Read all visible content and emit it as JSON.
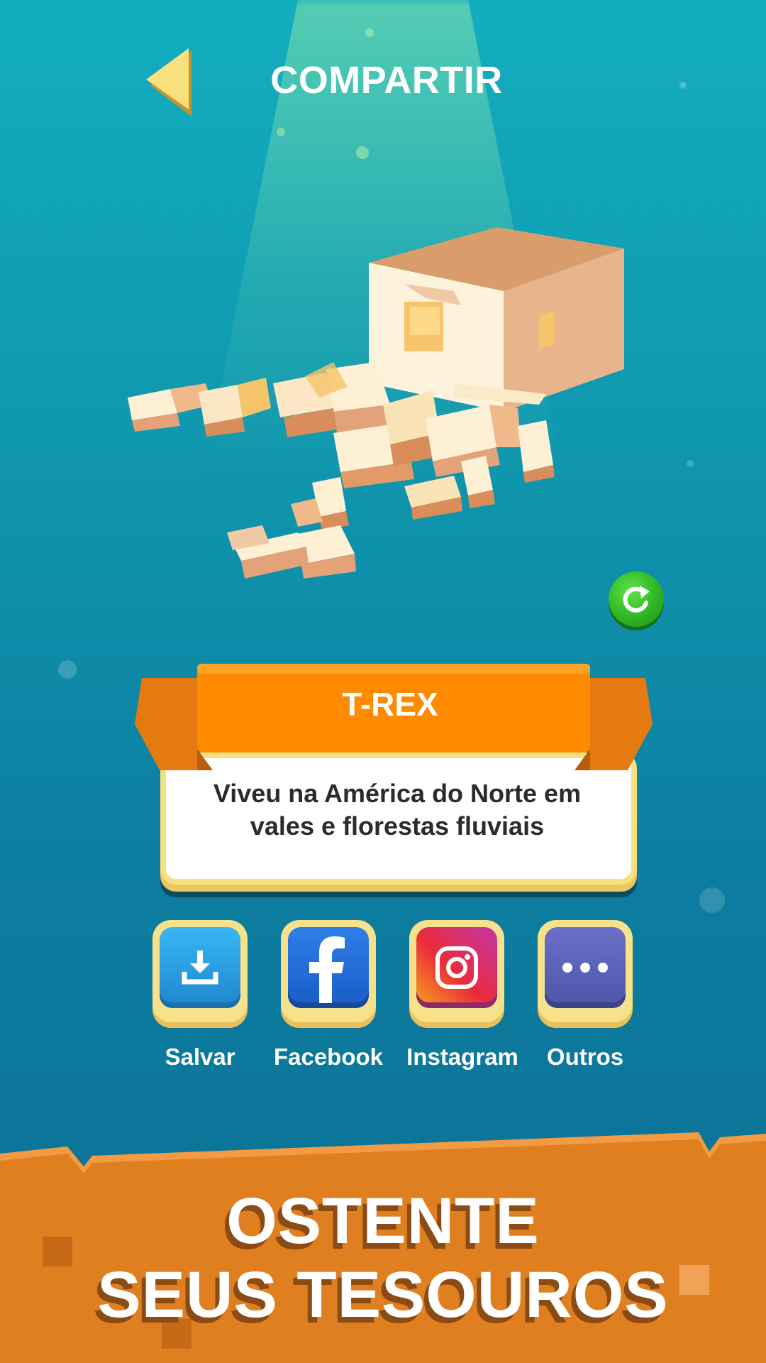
{
  "header": {
    "title": "COMPARTIR"
  },
  "creature": {
    "name": "T-REX",
    "description_line1": "Viveu na América do Norte em",
    "description_line2": "vales e florestas fluviais"
  },
  "share": {
    "buttons": [
      {
        "label": "Salvar",
        "icon": "download-icon"
      },
      {
        "label": "Facebook",
        "icon": "facebook-icon"
      },
      {
        "label": "Instagram",
        "icon": "instagram-icon"
      },
      {
        "label": "Outros",
        "icon": "more-icon"
      }
    ]
  },
  "banner": {
    "line1": "OSTENTE",
    "line2": "SEUS TESOUROS"
  },
  "colors": {
    "background": "#0f95ad",
    "ribbon": "#ff8a00",
    "banner": "#e07f1f",
    "card_border": "#f6e07f",
    "refresh": "#2fb624"
  }
}
